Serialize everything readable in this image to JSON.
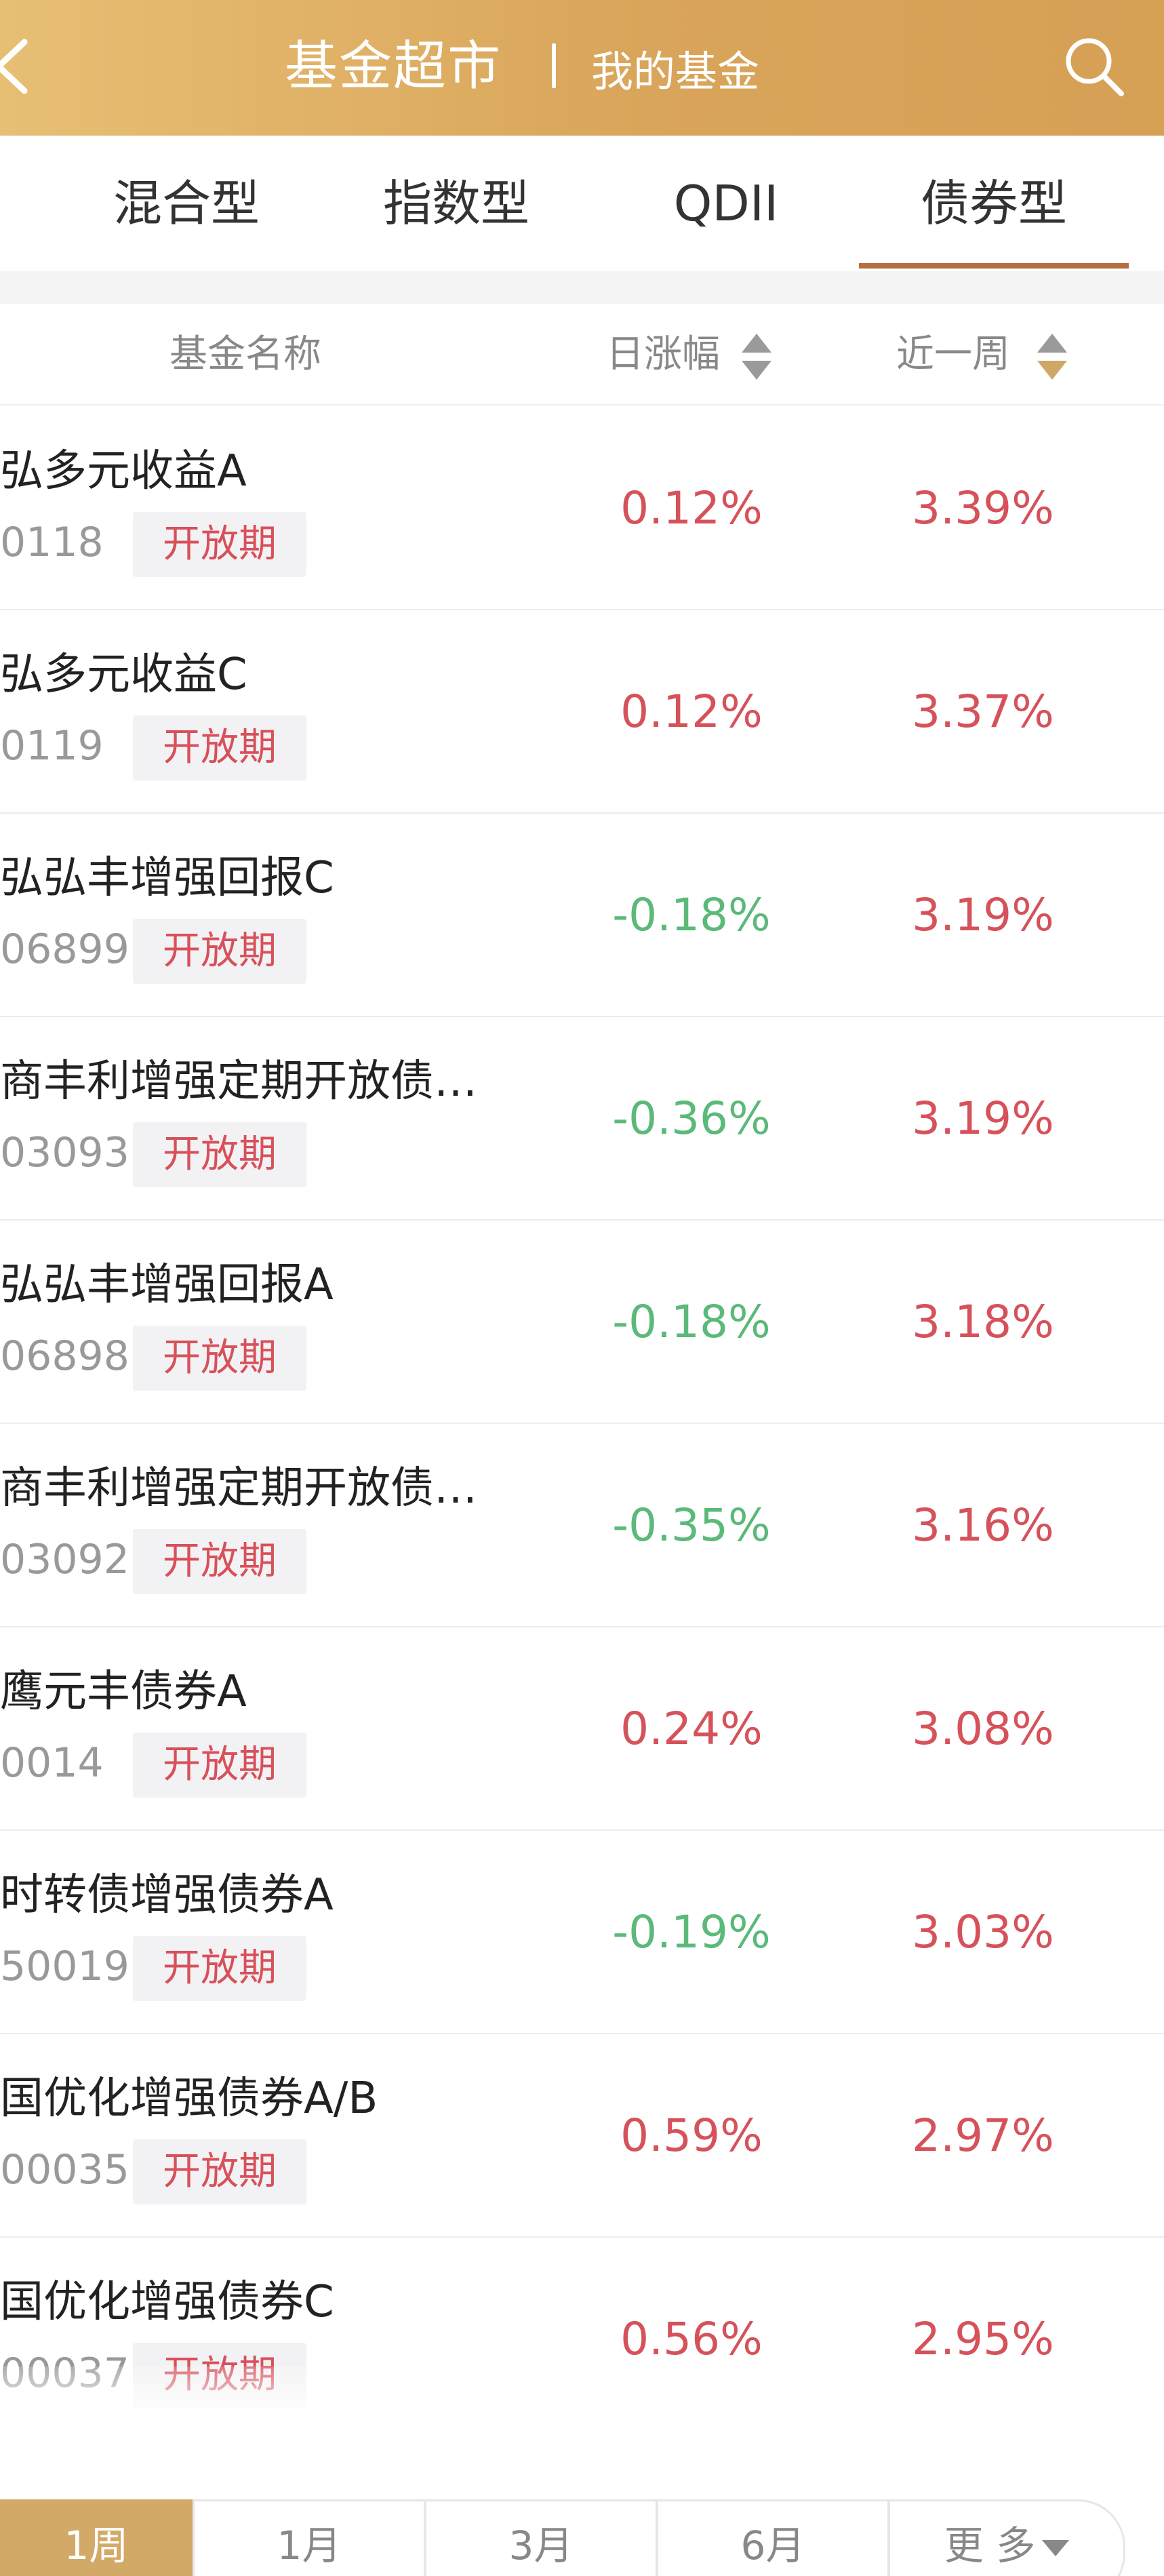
{
  "header": {
    "title": "基金超市",
    "my_funds": "我的基金"
  },
  "tabs": [
    {
      "label": "混合型"
    },
    {
      "label": "指数型"
    },
    {
      "label": "QDII"
    },
    {
      "label": "债券型"
    }
  ],
  "active_tab": "债券型",
  "columns": {
    "name": "基金名称",
    "daily": "日涨幅",
    "weekly": "近一周"
  },
  "colors": {
    "header_gradient_start": "#e7bf74",
    "header_gradient_end": "#d6a055",
    "active_tab_underline": "#b86d3e",
    "positive": "#d6525b",
    "negative": "#5bb979",
    "badge_text": "#d8505a",
    "period_active": "#d2a966"
  },
  "funds": [
    {
      "name": "弘多元收益A",
      "code": "0118",
      "badge": "开放期",
      "daily": "0.12%",
      "weekly": "3.39%",
      "daily_dir": "up"
    },
    {
      "name": "弘多元收益C",
      "code": "0119",
      "badge": "开放期",
      "daily": "0.12%",
      "weekly": "3.37%",
      "daily_dir": "up"
    },
    {
      "name": "弘弘丰增强回报C",
      "code": "06899",
      "badge": "开放期",
      "daily": "-0.18%",
      "weekly": "3.19%",
      "daily_dir": "down"
    },
    {
      "name": "商丰利增强定期开放债…",
      "code": "03093",
      "badge": "开放期",
      "daily": "-0.36%",
      "weekly": "3.19%",
      "daily_dir": "down"
    },
    {
      "name": "弘弘丰增强回报A",
      "code": "06898",
      "badge": "开放期",
      "daily": "-0.18%",
      "weekly": "3.18%",
      "daily_dir": "down"
    },
    {
      "name": "商丰利增强定期开放债…",
      "code": "03092",
      "badge": "开放期",
      "daily": "-0.35%",
      "weekly": "3.16%",
      "daily_dir": "down"
    },
    {
      "name": "鹰元丰债券A",
      "code": "0014",
      "badge": "开放期",
      "daily": "0.24%",
      "weekly": "3.08%",
      "daily_dir": "up"
    },
    {
      "name": "时转债增强债券A",
      "code": "50019",
      "badge": "开放期",
      "daily": "-0.19%",
      "weekly": "3.03%",
      "daily_dir": "down"
    },
    {
      "name": "国优化增强债券A/B",
      "code": "00035",
      "badge": "开放期",
      "daily": "0.59%",
      "weekly": "2.97%",
      "daily_dir": "up"
    },
    {
      "name": "国优化增强债券C",
      "code": "00037",
      "badge": "开放期",
      "daily": "0.56%",
      "weekly": "2.95%",
      "daily_dir": "up"
    }
  ],
  "periods": [
    {
      "label": "1周"
    },
    {
      "label": "1月"
    },
    {
      "label": "3月"
    },
    {
      "label": "6月"
    },
    {
      "label": "更 多"
    }
  ],
  "active_period": "1周",
  "icons": [
    "back-arrow-icon",
    "search-icon",
    "sort-arrows-icon",
    "chevron-down-icon"
  ]
}
